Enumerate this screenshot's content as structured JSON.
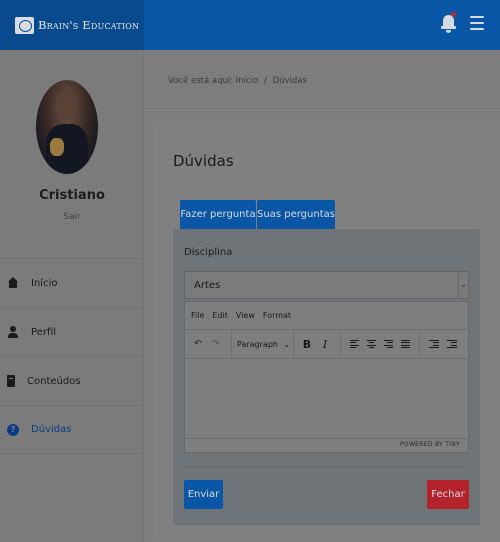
{
  "brand": {
    "name": "Brain's Education"
  },
  "header": {
    "notification_icon": "bell-icon",
    "menu_icon": "hamburger-icon"
  },
  "sidebar": {
    "user": {
      "name": "Cristiano",
      "logout": "Sair"
    },
    "items": [
      {
        "label": "Início",
        "icon": "home-icon"
      },
      {
        "label": "Perfil",
        "icon": "user-icon"
      },
      {
        "label": "Conteúdos",
        "icon": "book-icon"
      },
      {
        "label": "Dúvidas",
        "icon": "question-icon",
        "active": true
      }
    ]
  },
  "breadcrumb": {
    "prefix": "Você está aqui:",
    "home": "Início",
    "separator": "/",
    "current": "Dúvidas"
  },
  "page": {
    "title": "Dúvidas"
  },
  "tabs": [
    {
      "label": "Fazer pergunta"
    },
    {
      "label": "Suas perguntas"
    }
  ],
  "form": {
    "discipline_label": "Disciplina",
    "discipline_value": "Artes",
    "editor": {
      "menu": [
        "File",
        "Edit",
        "View",
        "Format"
      ],
      "block_format": "Paragraph",
      "bold": "B",
      "italic": "I",
      "powered_by": "POWERED BY TINY"
    },
    "submit_label": "Enviar",
    "close_label": "Fechar"
  },
  "colors": {
    "primary": "#0a56a6",
    "danger": "#b4232c",
    "overlay": "#7f7f7f"
  }
}
